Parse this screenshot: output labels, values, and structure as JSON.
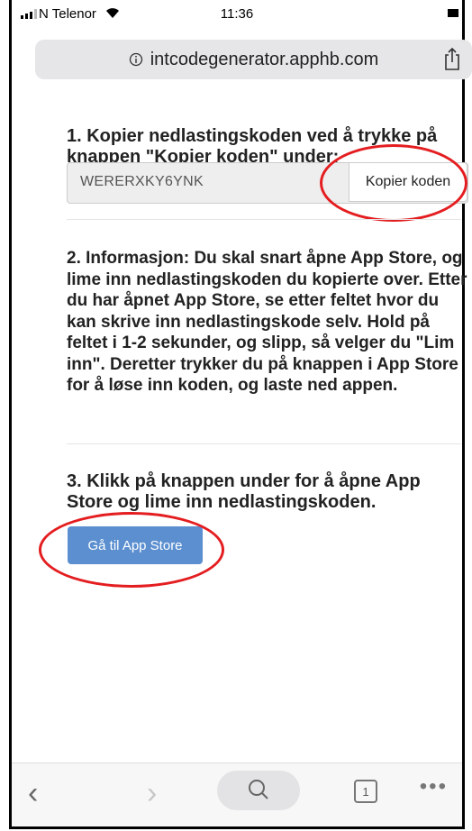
{
  "status": {
    "carrier": "N Telenor",
    "time": "11:36"
  },
  "browser": {
    "url": "intcodegenerator.apphb.com",
    "tab_count": "1"
  },
  "step1": {
    "title": "1. Kopier nedlastingskoden ved å trykke på knappen \"Kopier koden\" under:",
    "code": "WERERXKY6YNK",
    "copy_label": "Kopier koden"
  },
  "step2": {
    "text": "2. Informasjon: Du skal snart åpne App Store, og lime inn nedlastingskoden du kopierte over. Etter du har åpnet App Store, se etter feltet hvor du kan skrive inn nedlastingskode selv. Hold på feltet i 1-2 sekunder, og slipp, så velger du \"Lim inn\". Deretter trykker du på knappen i App Store for å løse inn koden, og laste ned appen."
  },
  "step3": {
    "title": "3. Klikk på knappen under for å åpne App Store og lime inn nedlastingskoden.",
    "button_label": "Gå til App Store"
  },
  "colors": {
    "accent_button": "#5b8fd0",
    "highlight_ring": "#e41d20"
  },
  "icons": {
    "info": "info-icon",
    "share": "share-icon",
    "back": "chevron-left-icon",
    "forward": "chevron-right-icon",
    "search": "search-icon",
    "tabs": "tabs-icon",
    "more": "more-icon"
  }
}
